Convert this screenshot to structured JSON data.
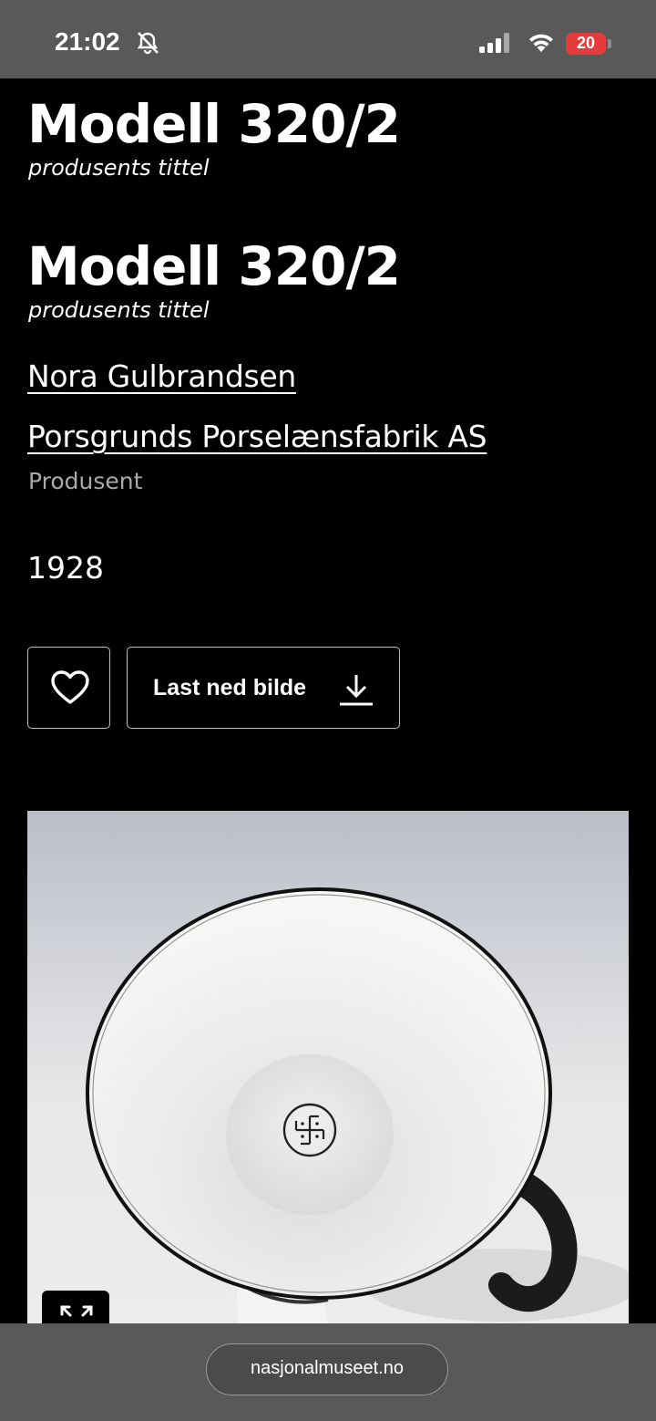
{
  "status_bar": {
    "time": "21:02",
    "battery": "20",
    "bell_icon": "bell-slash-icon",
    "signal_icon": "cellular-signal-icon",
    "wifi_icon": "wifi-icon",
    "battery_color": "#e53b3b"
  },
  "artwork": {
    "titles": [
      {
        "title": "Modell 320/2",
        "subtitle": "produsents tittel"
      },
      {
        "title": "Modell 320/2",
        "subtitle": "produsents tittel"
      }
    ],
    "artist": "Nora Gulbrandsen",
    "producer": "Porsgrunds Porselænsfabrik AS",
    "producer_role": "Produsent",
    "year": "1928"
  },
  "actions": {
    "favorite_icon": "heart-icon",
    "download_label": "Last ned bilde",
    "download_icon": "download-icon",
    "expand_icon": "expand-icon"
  },
  "browser": {
    "url": "nasjonalmuseet.no"
  }
}
